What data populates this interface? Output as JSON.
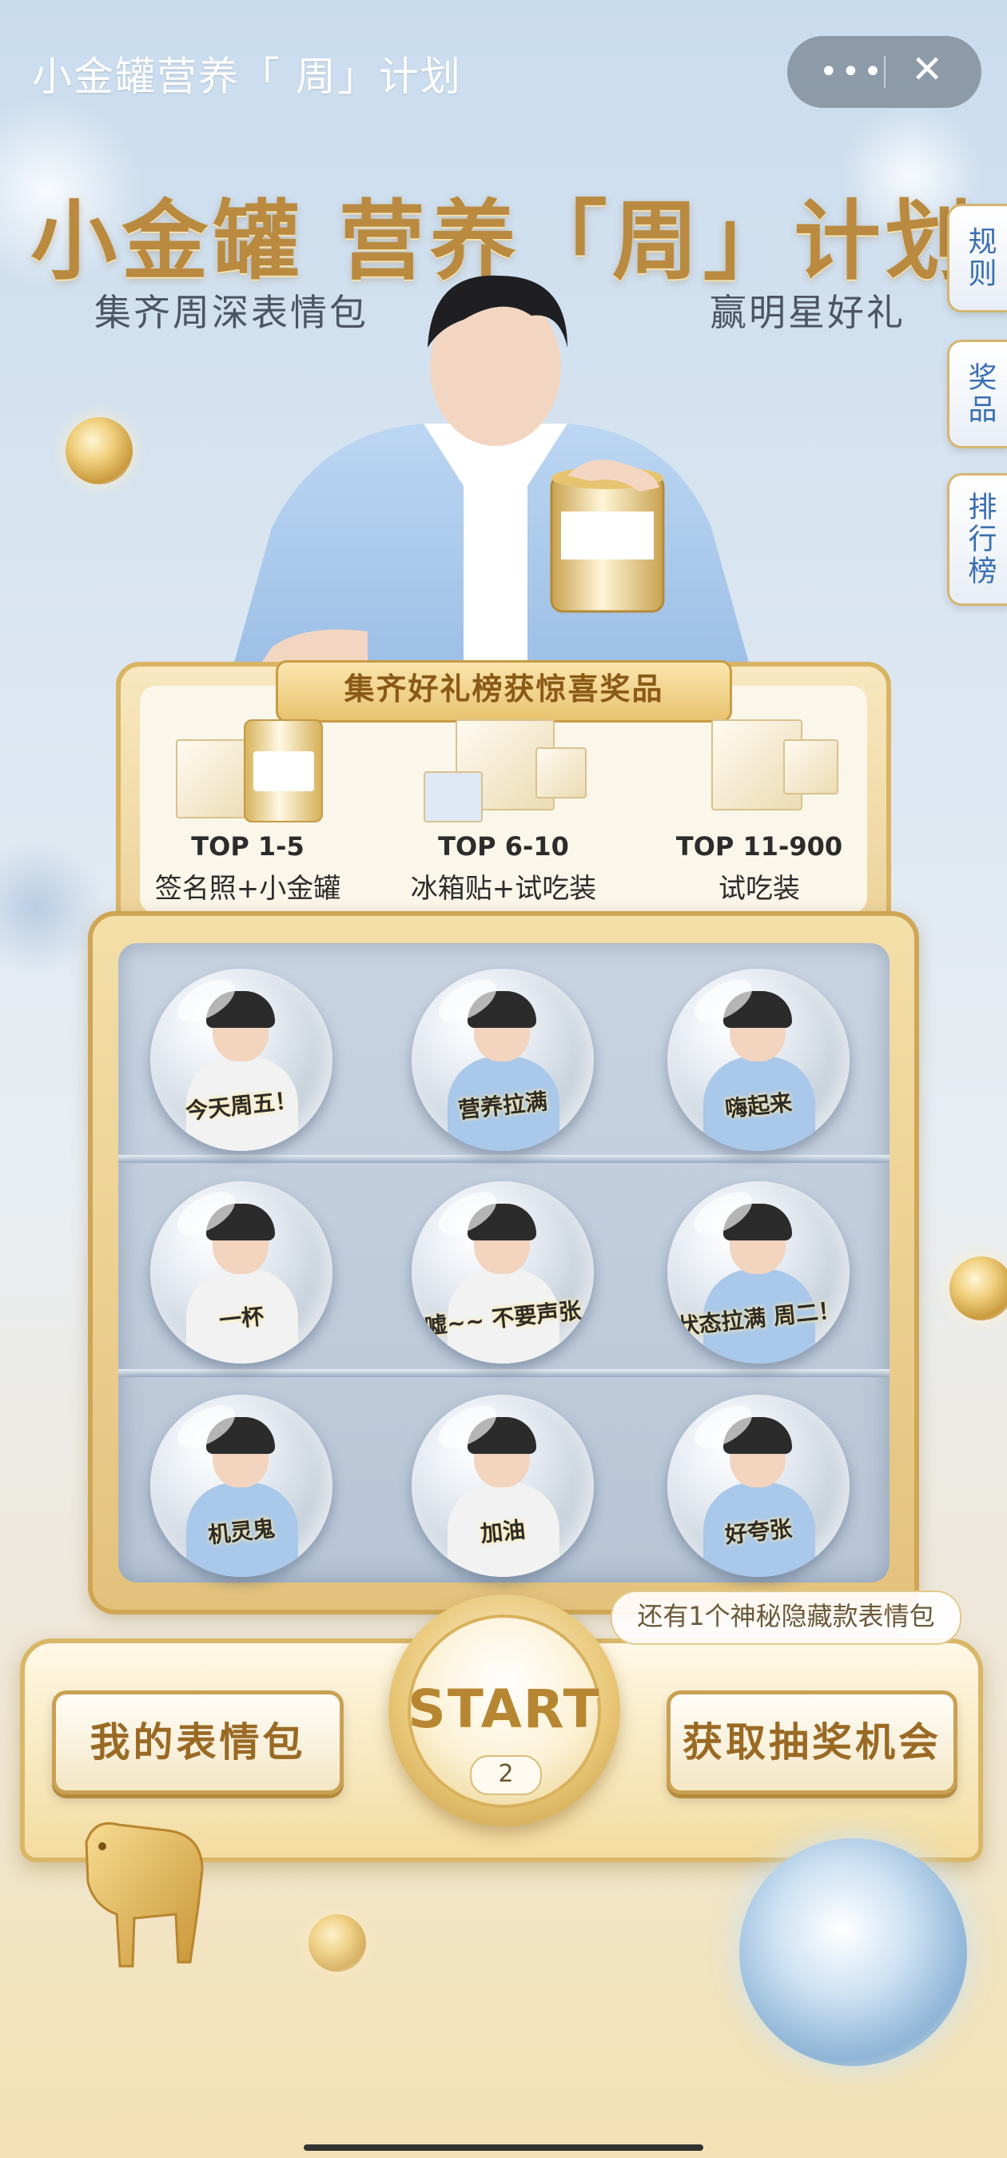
{
  "header": {
    "title": "小金罐营养「 周」计划",
    "more_icon": "more-icon",
    "close_icon": "close-icon"
  },
  "hero": {
    "headline": "小金罐 营养「周」计划",
    "subtitle_left": "集齐周深表情包",
    "subtitle_right": "赢明星好礼"
  },
  "side_tabs": [
    {
      "label": "规则"
    },
    {
      "label": "奖品"
    },
    {
      "label": "排行榜"
    }
  ],
  "prizes": {
    "banner": "集齐好礼榜获惊喜奖品",
    "items": [
      {
        "rank": "TOP 1-5",
        "desc": "签名照+小金罐"
      },
      {
        "rank": "TOP 6-10",
        "desc": "冰箱贴+试吃装"
      },
      {
        "rank": "TOP 11-900",
        "desc": "试吃装"
      }
    ]
  },
  "stickers": [
    {
      "caption": "今天周五！"
    },
    {
      "caption": "营养拉满"
    },
    {
      "caption": "嗨起来"
    },
    {
      "caption": "一杯"
    },
    {
      "caption": "嘘~~ 不要声张"
    },
    {
      "caption": "状态拉满 周二！"
    },
    {
      "caption": "机灵鬼"
    },
    {
      "caption": "加油"
    },
    {
      "caption": "好夸张"
    }
  ],
  "controls": {
    "hint": "还有1个神秘隐藏款表情包",
    "my_stickers": "我的表情包",
    "start": "START",
    "start_count": "2",
    "get_chance": "获取抽奖机会"
  },
  "colors": {
    "gold": "#d8b463",
    "gold_text": "#b98a3f",
    "tab_text": "#3a6fb0"
  }
}
